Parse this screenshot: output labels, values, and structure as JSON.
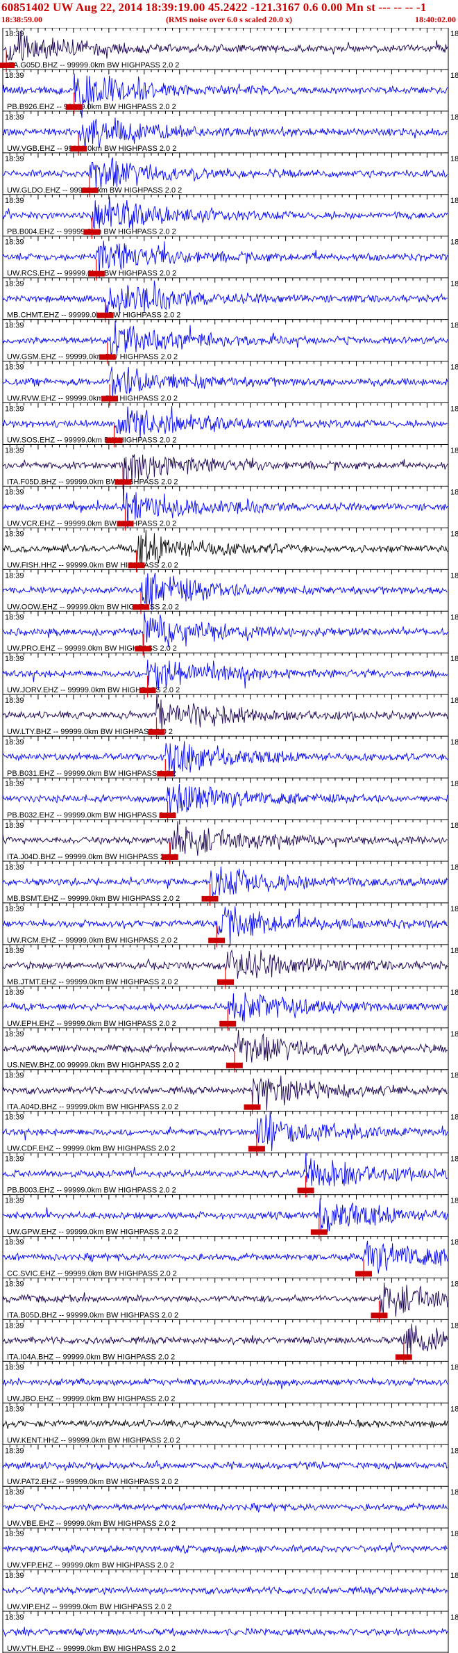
{
  "header": {
    "title": "60851402 UW Aug 22, 2014 18:39:19.00   45.2422 -121.3167  0.6 0.00 Mn st --- -- --  -1",
    "start_time": "18:38:59.00",
    "end_time": "18:40:02.00",
    "note": "(RMS noise over 6.0 s scaled 20.0 x)"
  },
  "time_label": "18:39",
  "colors": {
    "blue": "#0000ff",
    "dark": "#1a0050",
    "black": "#000000",
    "pick": "#ff0000",
    "pick_box": "#cc0000",
    "text": "#000000"
  },
  "traces": [
    {
      "label": "ITA.G05D.BHZ -- 99999.0km BW  HIGHPASS  2.0  2",
      "color": "dark",
      "pick": 0.008
    },
    {
      "label": "PB.B926.EHZ -- 99999.0km BW  HIGHPASS  2.0  2",
      "color": "blue",
      "pick": 0.16
    },
    {
      "label": "UW.VGB.EHZ -- 99999.0km BW  HIGHPASS  2.0  2",
      "color": "blue",
      "pick": 0.17
    },
    {
      "label": "UW.GLDO.EHZ -- 99999.0km BW  HIGHPASS  2.0  2",
      "color": "blue",
      "pick": 0.195
    },
    {
      "label": "PB.B004.EHZ -- 99999.0km BW  HIGHPASS  2.0  2",
      "color": "blue",
      "pick": 0.2
    },
    {
      "label": "UW.RCS.EHZ -- 99999.0km BW  HIGHPASS  2.0  2",
      "color": "blue",
      "pick": 0.21
    },
    {
      "label": "MB.CHMT.EHZ -- 99999.0km BW  HIGHPASS  2.0  2",
      "color": "blue",
      "pick": 0.23
    },
    {
      "label": "UW.GSM.EHZ -- 99999.0km BW  HIGHPASS  2.0  2",
      "color": "blue",
      "pick": 0.235
    },
    {
      "label": "UW.RVW.EHZ -- 99999.0km BW  HIGHPASS  2.0  2",
      "color": "blue",
      "pick": 0.24
    },
    {
      "label": "UW.SOS.EHZ -- 99999.0km BW  HIGHPASS  2.0  2",
      "color": "blue",
      "pick": 0.25
    },
    {
      "label": "ITA.F05D.BHZ -- 99999.0km BW  HIGHPASS  2.0  2",
      "color": "dark",
      "pick": 0.27
    },
    {
      "label": "UW.VCR.EHZ -- 99999.0km BW  HIGHPASS  2.0  2",
      "color": "blue",
      "pick": 0.275
    },
    {
      "label": "UW.FISH.HHZ -- 99999.0km BW  HIGHPASS  2.0  2",
      "color": "black",
      "pick": 0.3
    },
    {
      "label": "UW.OOW.EHZ -- 99999.0km BW  HIGHPASS  2.0  2",
      "color": "blue",
      "pick": 0.31
    },
    {
      "label": "UW.PRO.EHZ -- 99999.0km BW  HIGHPASS  2.0  2",
      "color": "blue",
      "pick": 0.315
    },
    {
      "label": "UW.JORV.EHZ -- 99999.0km BW  HIGHPASS  2.0  2",
      "color": "blue",
      "pick": 0.325
    },
    {
      "label": "UW.LTY.BHZ -- 99999.0km BW  HIGHPASS  2.0  2",
      "color": "dark",
      "pick": 0.345
    },
    {
      "label": "PB.B031.EHZ -- 99999.0km BW  HIGHPASS  2.0  2",
      "color": "blue",
      "pick": 0.365
    },
    {
      "label": "PB.B032.EHZ -- 99999.0km BW  HIGHPASS  2.0  2",
      "color": "blue",
      "pick": 0.37
    },
    {
      "label": "ITA.J04D.BHZ -- 99999.0km BW  HIGHPASS  2.0  2",
      "color": "dark",
      "pick": 0.375
    },
    {
      "label": "MB.BSMT.EHZ -- 99999.0km BW  HIGHPASS  2.0  2",
      "color": "blue",
      "pick": 0.465
    },
    {
      "label": "UW.RCM.EHZ -- 99999.0km BW  HIGHPASS  2.0  2",
      "color": "blue",
      "pick": 0.48
    },
    {
      "label": "MB.JTMT.EHZ -- 99999.0km BW  HIGHPASS  2.0  2",
      "color": "dark",
      "pick": 0.5
    },
    {
      "label": "UW.EPH.EHZ -- 99999.0km BW  HIGHPASS  2.0  2",
      "color": "blue",
      "pick": 0.505
    },
    {
      "label": "US.NEW.BHZ.00 99999.0km BW  HIGHPASS  2.0  2",
      "color": "dark",
      "pick": 0.52
    },
    {
      "label": "ITA.A04D.BHZ -- 99999.0km BW  HIGHPASS  2.0  2",
      "color": "dark",
      "pick": 0.56
    },
    {
      "label": "UW.CDF.EHZ -- 99999.0km BW  HIGHPASS  2.0  2",
      "color": "blue",
      "pick": 0.57
    },
    {
      "label": "PB.B003.EHZ -- 99999.0km BW  HIGHPASS  2.0  2",
      "color": "blue",
      "pick": 0.68
    },
    {
      "label": "UW.GPW.EHZ -- 99999.0km BW  HIGHPASS  2.0  2",
      "color": "blue",
      "pick": 0.71
    },
    {
      "label": "CC.SVIC.EHZ -- 99999.0km BW  HIGHPASS  2.0  2",
      "color": "blue",
      "pick": 0.81
    },
    {
      "label": "ITA.B05D.BHZ -- 99999.0km BW  HIGHPASS  2.0  2",
      "color": "dark",
      "pick": 0.845
    },
    {
      "label": "ITA.I04A.BHZ -- 99999.0km BW  HIGHPASS  2.0  2",
      "color": "dark",
      "pick": 0.9
    },
    {
      "label": "UW.JBO.EHZ -- 99999.0km BW  HIGHPASS  2.0  2",
      "color": "blue",
      "pick": null
    },
    {
      "label": "UW.KENT.HHZ -- 99999.0km BW  HIGHPASS  2.0  2",
      "color": "black",
      "pick": null
    },
    {
      "label": "UW.PAT2.EHZ -- 99999.0km BW  HIGHPASS  2.0  2",
      "color": "blue",
      "pick": null
    },
    {
      "label": "UW.VBE.EHZ -- 99999.0km BW  HIGHPASS  2.0  2",
      "color": "blue",
      "pick": null
    },
    {
      "label": "UW.VFP.EHZ -- 99999.0km BW  HIGHPASS  2.0  2",
      "color": "blue",
      "pick": null
    },
    {
      "label": "UW.VIP.EHZ -- 99999.0km BW  HIGHPASS  2.0  2",
      "color": "blue",
      "pick": null
    },
    {
      "label": "UW.VTH.EHZ -- 99999.0km BW  HIGHPASS  2.0  2",
      "color": "blue",
      "pick": null
    }
  ]
}
